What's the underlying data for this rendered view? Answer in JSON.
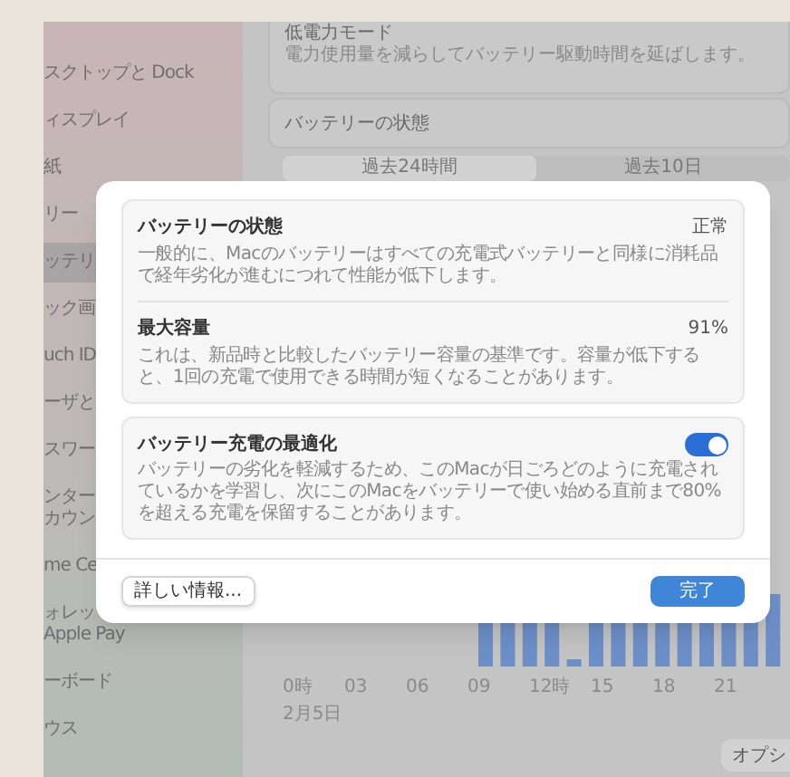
{
  "sidebar": {
    "items": [
      {
        "lines": [
          "スクトップと Dock"
        ],
        "selected": false
      },
      {
        "lines": [
          "ィスプレイ"
        ],
        "selected": false
      },
      {
        "lines": [
          "紙"
        ],
        "selected": false
      },
      {
        "lines": [
          "リー"
        ],
        "selected": false
      },
      {
        "lines": [
          "ッテリ"
        ],
        "selected": true
      },
      {
        "lines": [
          "ック画"
        ],
        "selected": false
      },
      {
        "lines": [
          "uch ID"
        ],
        "selected": false
      },
      {
        "lines": [
          "ーザと"
        ],
        "selected": false
      },
      {
        "lines": [
          "スワー"
        ],
        "selected": false
      },
      {
        "lines": [
          "ンター",
          "カウン"
        ],
        "selected": false
      },
      {
        "lines": [
          "me Ce"
        ],
        "selected": false
      },
      {
        "lines": [
          "ォレッ",
          "Apple Pay"
        ],
        "selected": false
      },
      {
        "lines": [
          "ーボード"
        ],
        "selected": false
      },
      {
        "lines": [
          "ウス"
        ],
        "selected": false
      }
    ]
  },
  "main": {
    "low_power": {
      "title": "低電力モード",
      "description": "電力使用量を減らしてバッテリー駆動時間を延ばします。"
    },
    "section_title": "バッテリーの状態",
    "tabs": [
      {
        "label": "過去24時間",
        "selected": true
      },
      {
        "label": "過去10日",
        "selected": false
      }
    ],
    "chart": {
      "x_labels": [
        "0時",
        "03",
        "06",
        "09",
        "12時",
        "15",
        "18",
        "21"
      ],
      "date": "2月5日"
    },
    "options_button": "オプシ"
  },
  "dialog": {
    "groups": [
      {
        "rows": [
          {
            "kind": "info",
            "title": "バッテリーの状態",
            "value": "正常",
            "description": "一般的に、Macのバッテリーはすべての充電式バッテリーと同様に消耗品で経年劣化が進むにつれて性能が低下します。"
          },
          {
            "kind": "info",
            "title": "最大容量",
            "value": "91%",
            "description": "これは、新品時と比較したバッテリー容量の基準です。容量が低下すると、1回の充電で使用できる時間が短くなることがあります。"
          }
        ]
      },
      {
        "rows": [
          {
            "kind": "toggle",
            "title": "バッテリー充電の最適化",
            "on": true,
            "description": "バッテリーの劣化を軽減するため、このMacが日ごろどのように充電されているかを学習し、次にこのMacをバッテリーで使い始める直前まで80%を超える充電を保留することがあります。"
          }
        ]
      }
    ],
    "buttons": [
      {
        "label": "詳しい情報...",
        "primary": false
      },
      {
        "label": "完了",
        "primary": true
      }
    ]
  }
}
